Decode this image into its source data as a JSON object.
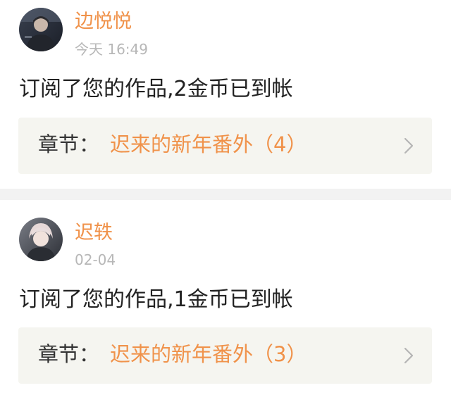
{
  "feed": {
    "items": [
      {
        "username": "边悦悦",
        "time": "今天 16:49",
        "message": "订阅了您的作品,2金币已到帐",
        "chapter_label": "章节：",
        "chapter_title": "迟来的新年番外（4）"
      },
      {
        "username": "迟轶",
        "time": "02-04",
        "message": "订阅了您的作品,1金币已到帐",
        "chapter_label": "章节：",
        "chapter_title": "迟来的新年番外（3）"
      }
    ]
  },
  "colors": {
    "accent": "#f0924a",
    "meta_text": "#b7b7b7",
    "chapter_bg": "#f5f5f0",
    "divider": "#f2f2f2"
  }
}
